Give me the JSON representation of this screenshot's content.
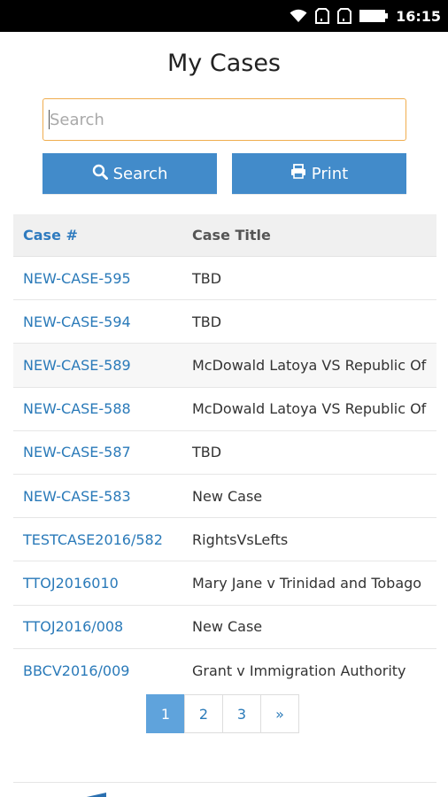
{
  "status_bar": {
    "time": "16:15",
    "icons": [
      "wifi-icon",
      "sim-icon",
      "sim-icon",
      "battery-icon"
    ]
  },
  "page": {
    "title": "My Cases"
  },
  "search": {
    "placeholder": "Search",
    "value": ""
  },
  "buttons": {
    "search_label": "Search",
    "print_label": "Print"
  },
  "table": {
    "columns": [
      "Case #",
      "Case Title"
    ],
    "rows": [
      {
        "case": "NEW-CASE-595",
        "title": "TBD"
      },
      {
        "case": "NEW-CASE-594",
        "title": "TBD"
      },
      {
        "case": "NEW-CASE-589",
        "title": "McDowald Latoya VS Republic Of"
      },
      {
        "case": "NEW-CASE-588",
        "title": "McDowald Latoya VS Republic Of"
      },
      {
        "case": "NEW-CASE-587",
        "title": "TBD"
      },
      {
        "case": "NEW-CASE-583",
        "title": "New Case"
      },
      {
        "case": "TESTCASE2016/582",
        "title": "RightsVsLefts"
      },
      {
        "case": "TTOJ2016010",
        "title": "Mary Jane v Trinidad and Tobago"
      },
      {
        "case": "TTOJ2016/008",
        "title": "New Case"
      },
      {
        "case": "BBCV2016/009",
        "title": "Grant v Immigration Authority"
      }
    ]
  },
  "pagination": {
    "pages": [
      "1",
      "2",
      "3",
      "»"
    ],
    "active": "1"
  },
  "colors": {
    "primary": "#428bca",
    "link": "#2a7ab9",
    "input_border": "#f0ad4e",
    "active_page": "#5fa3dc"
  }
}
